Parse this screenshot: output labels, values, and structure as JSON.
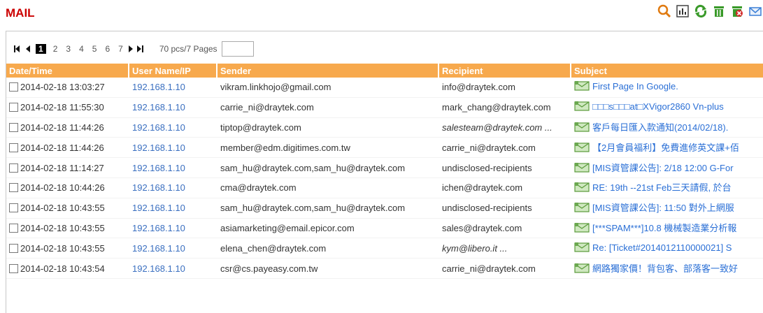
{
  "header": {
    "title": "MAIL"
  },
  "toolbar": {
    "icons": [
      "search-icon",
      "export-icon",
      "refresh-icon",
      "delete-icon",
      "delete-all-icon",
      "mail-icon"
    ]
  },
  "pager": {
    "pages": [
      "1",
      "2",
      "3",
      "4",
      "5",
      "6",
      "7"
    ],
    "active_page": "1",
    "total": "70 pcs/7 Pages",
    "jump_value": ""
  },
  "table": {
    "columns": [
      "Date/Time",
      "User Name/IP",
      "Sender",
      "Recipient",
      "Subject"
    ],
    "rows": [
      {
        "datetime": "2014-02-18 13:03:27",
        "ip": "192.168.1.10",
        "sender": "vikram.linkhojo@gmail.com",
        "recipient": "info@draytek.com",
        "subject": "First Page In Google."
      },
      {
        "datetime": "2014-02-18 11:55:30",
        "ip": "192.168.1.10",
        "sender": "carrie_ni@draytek.com",
        "recipient": "mark_chang@draytek.com",
        "subject": "□□□s□□□at□XVigor2860 Vn-plus"
      },
      {
        "datetime": "2014-02-18 11:44:26",
        "ip": "192.168.1.10",
        "sender": "tiptop@draytek.com",
        "recipient": "salesteam@draytek.com ...",
        "subject": "客戶每日匯入款通知(2014/02/18)."
      },
      {
        "datetime": "2014-02-18 11:44:26",
        "ip": "192.168.1.10",
        "sender": "member@edm.digitimes.com.tw",
        "recipient": "carrie_ni@draytek.com",
        "subject": "【2月會員福利】免費進修英文課+佰"
      },
      {
        "datetime": "2014-02-18 11:14:27",
        "ip": "192.168.1.10",
        "sender": "sam_hu@draytek.com,sam_hu@draytek.com",
        "recipient": "undisclosed-recipients",
        "subject": "[MIS資管課公告]: 2/18 12:00 G-For"
      },
      {
        "datetime": "2014-02-18 10:44:26",
        "ip": "192.168.1.10",
        "sender": "cma@draytek.com",
        "recipient": "ichen@draytek.com",
        "subject": "RE: 19th --21st Feb三天請假, 於台"
      },
      {
        "datetime": "2014-02-18 10:43:55",
        "ip": "192.168.1.10",
        "sender": "sam_hu@draytek.com,sam_hu@draytek.com",
        "recipient": "undisclosed-recipients",
        "subject": "[MIS資管課公告]: 11:50 對外上網服"
      },
      {
        "datetime": "2014-02-18 10:43:55",
        "ip": "192.168.1.10",
        "sender": "asiamarketing@email.epicor.com",
        "recipient": "sales@draytek.com",
        "subject": "[***SPAM***]10.8 機械製造業分析報"
      },
      {
        "datetime": "2014-02-18 10:43:55",
        "ip": "192.168.1.10",
        "sender": "elena_chen@draytek.com",
        "recipient": "kym@libero.it ...",
        "subject": "Re: [Ticket#2014012110000021] S"
      },
      {
        "datetime": "2014-02-18 10:43:54",
        "ip": "192.168.1.10",
        "sender": "csr@cs.payeasy.com.tw",
        "recipient": "carrie_ni@draytek.com",
        "subject": "網路獨家價！背包客、部落客一致好"
      }
    ]
  }
}
